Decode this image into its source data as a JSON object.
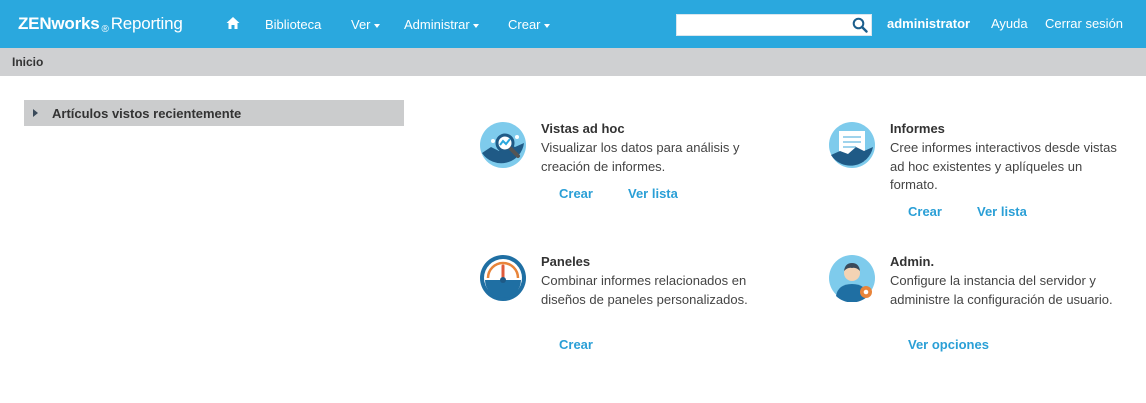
{
  "header": {
    "brand": "ZENworks",
    "brand_reg": "®",
    "brand_product": "Reporting",
    "nav": {
      "biblioteca": "Biblioteca",
      "ver": "Ver",
      "administrar": "Administrar",
      "crear": "Crear"
    },
    "search_placeholder": "",
    "user": "administrator",
    "help": "Ayuda",
    "logout": "Cerrar sesión"
  },
  "breadcrumb": "Inicio",
  "recent": {
    "label": "Artículos vistos recientemente"
  },
  "cards": [
    {
      "title": "Vistas ad hoc",
      "description": "Visualizar los datos para análisis y creación de informes.",
      "links": [
        "Crear",
        "Ver lista"
      ]
    },
    {
      "title": "Informes",
      "description": "Cree informes interactivos desde vistas ad hoc existentes y aplíqueles un formato.",
      "links": [
        "Crear",
        "Ver lista"
      ]
    },
    {
      "title": "Paneles",
      "description": "Combinar informes relacionados en diseños de paneles personalizados.",
      "links": [
        "Crear"
      ]
    },
    {
      "title": "Admin.",
      "description": "Configure la instancia del servidor y administre la configuración de usuario.",
      "links": [
        "Ver opciones"
      ]
    }
  ],
  "colors": {
    "header_bg": "#2aa8de",
    "subbar_bg": "#cfd0d2",
    "link": "#2a9fd6",
    "icon_bg": "#7ecbec",
    "icon_dark": "#1f5a86"
  }
}
